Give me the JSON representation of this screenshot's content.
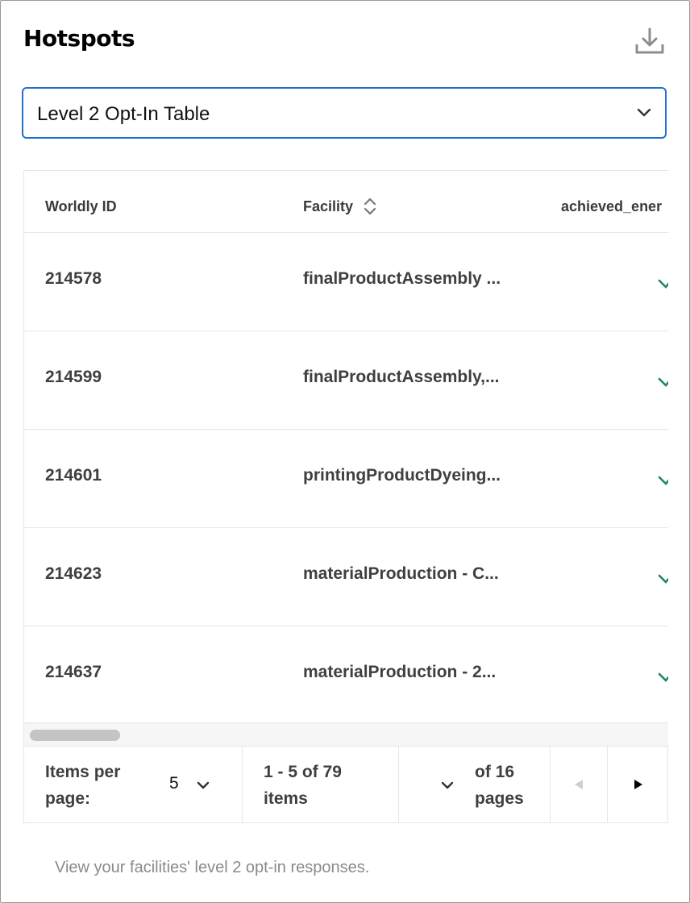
{
  "header": {
    "title": "Hotspots",
    "download_icon": "download-icon"
  },
  "selector": {
    "selected": "Level 2 Opt-In Table",
    "icon": "chevron-down-icon"
  },
  "table": {
    "columns": [
      "Worldly ID",
      "Facility",
      "achieved_ener"
    ],
    "rows": [
      {
        "id": "214578",
        "facility": "finalProductAssembly ...",
        "achieved": "check"
      },
      {
        "id": "214599",
        "facility": "finalProductAssembly,...",
        "achieved": "check"
      },
      {
        "id": "214601",
        "facility": "printingProductDyeing...",
        "achieved": "check"
      },
      {
        "id": "214623",
        "facility": "materialProduction - C...",
        "achieved": "check"
      },
      {
        "id": "214637",
        "facility": "materialProduction - 2...",
        "achieved": "check"
      }
    ]
  },
  "pagination": {
    "items_per_page_label_1": "Items per",
    "items_per_page_label_2": "page:",
    "items_per_page_value": "5",
    "range_line_1": "1 - 5 of 79",
    "range_line_2": "items",
    "page_total_line_1": "of 16",
    "page_total_line_2": "pages"
  },
  "footer": {
    "description": "View your facilities' level 2 opt-in responses."
  },
  "colors": {
    "accent": "#1f6fd0",
    "check": "#1a8a5a",
    "text": "#3f3f3f"
  }
}
